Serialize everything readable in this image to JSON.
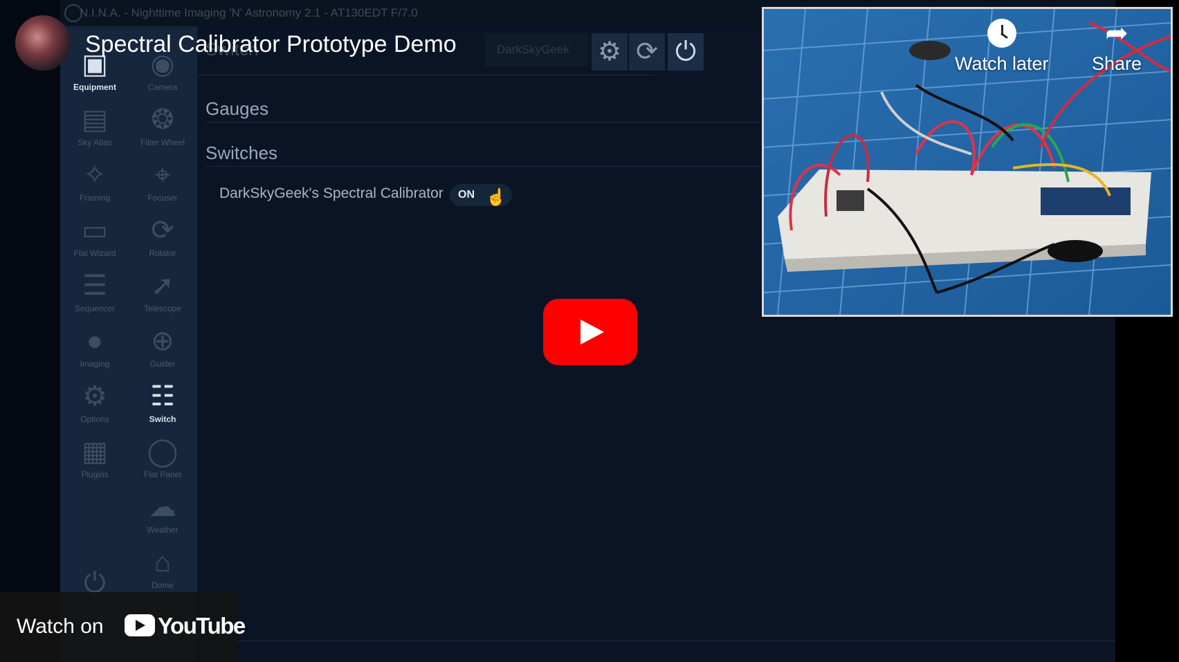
{
  "app": {
    "titlebar": "N.I.N.A. - Nighttime Imaging 'N' Astronomy 2.1 - AT130EDT F/7.0",
    "sidebar": [
      {
        "name": "equipment",
        "label": "Equipment",
        "icon": "monitor-icon",
        "active": true
      },
      {
        "name": "camera",
        "label": "Camera",
        "icon": "camera-icon"
      },
      {
        "name": "sky-atlas",
        "label": "Sky Atlas",
        "icon": "map-icon"
      },
      {
        "name": "filter-wheel",
        "label": "Filter Wheel",
        "icon": "filter-wheel-icon"
      },
      {
        "name": "framing",
        "label": "Framing",
        "icon": "framing-icon"
      },
      {
        "name": "focuser",
        "label": "Focuser",
        "icon": "focuser-icon"
      },
      {
        "name": "flat-wizard",
        "label": "Flat Wizard",
        "icon": "flat-wizard-icon"
      },
      {
        "name": "rotator",
        "label": "Rotator",
        "icon": "rotator-icon"
      },
      {
        "name": "sequencer",
        "label": "Sequencer",
        "icon": "sequencer-icon"
      },
      {
        "name": "telescope",
        "label": "Telescope",
        "icon": "telescope-icon"
      },
      {
        "name": "imaging",
        "label": "Imaging",
        "icon": "imaging-icon"
      },
      {
        "name": "guider",
        "label": "Guider",
        "icon": "guider-icon"
      },
      {
        "name": "options",
        "label": "Options",
        "icon": "gears-icon"
      },
      {
        "name": "switch",
        "label": "Switch",
        "icon": "sliders-icon",
        "active": true
      },
      {
        "name": "plugins",
        "label": "Plugins",
        "icon": "puzzle-icon"
      },
      {
        "name": "flat-panel",
        "label": "Flat Panel",
        "icon": "lightbulb-icon"
      },
      {
        "name": "weather",
        "label": "Weather",
        "icon": "cloud-icon"
      },
      {
        "name": "dome",
        "label": "Dome",
        "icon": "dome-icon"
      }
    ],
    "tab_title": "Switch",
    "device_select": "DarkSkyGeek",
    "sections": {
      "gauges": "Gauges",
      "switches": "Switches"
    },
    "switch_item": {
      "label": "DarkSkyGeek's Spectral Calibrator",
      "state": "ON"
    }
  },
  "youtube": {
    "title": "Spectral Calibrator Prototype Demo",
    "watch_later": "Watch later",
    "share": "Share",
    "watch_on": "Watch on",
    "logo_word": "YouTube",
    "colors": {
      "play": "#ff0000"
    }
  }
}
